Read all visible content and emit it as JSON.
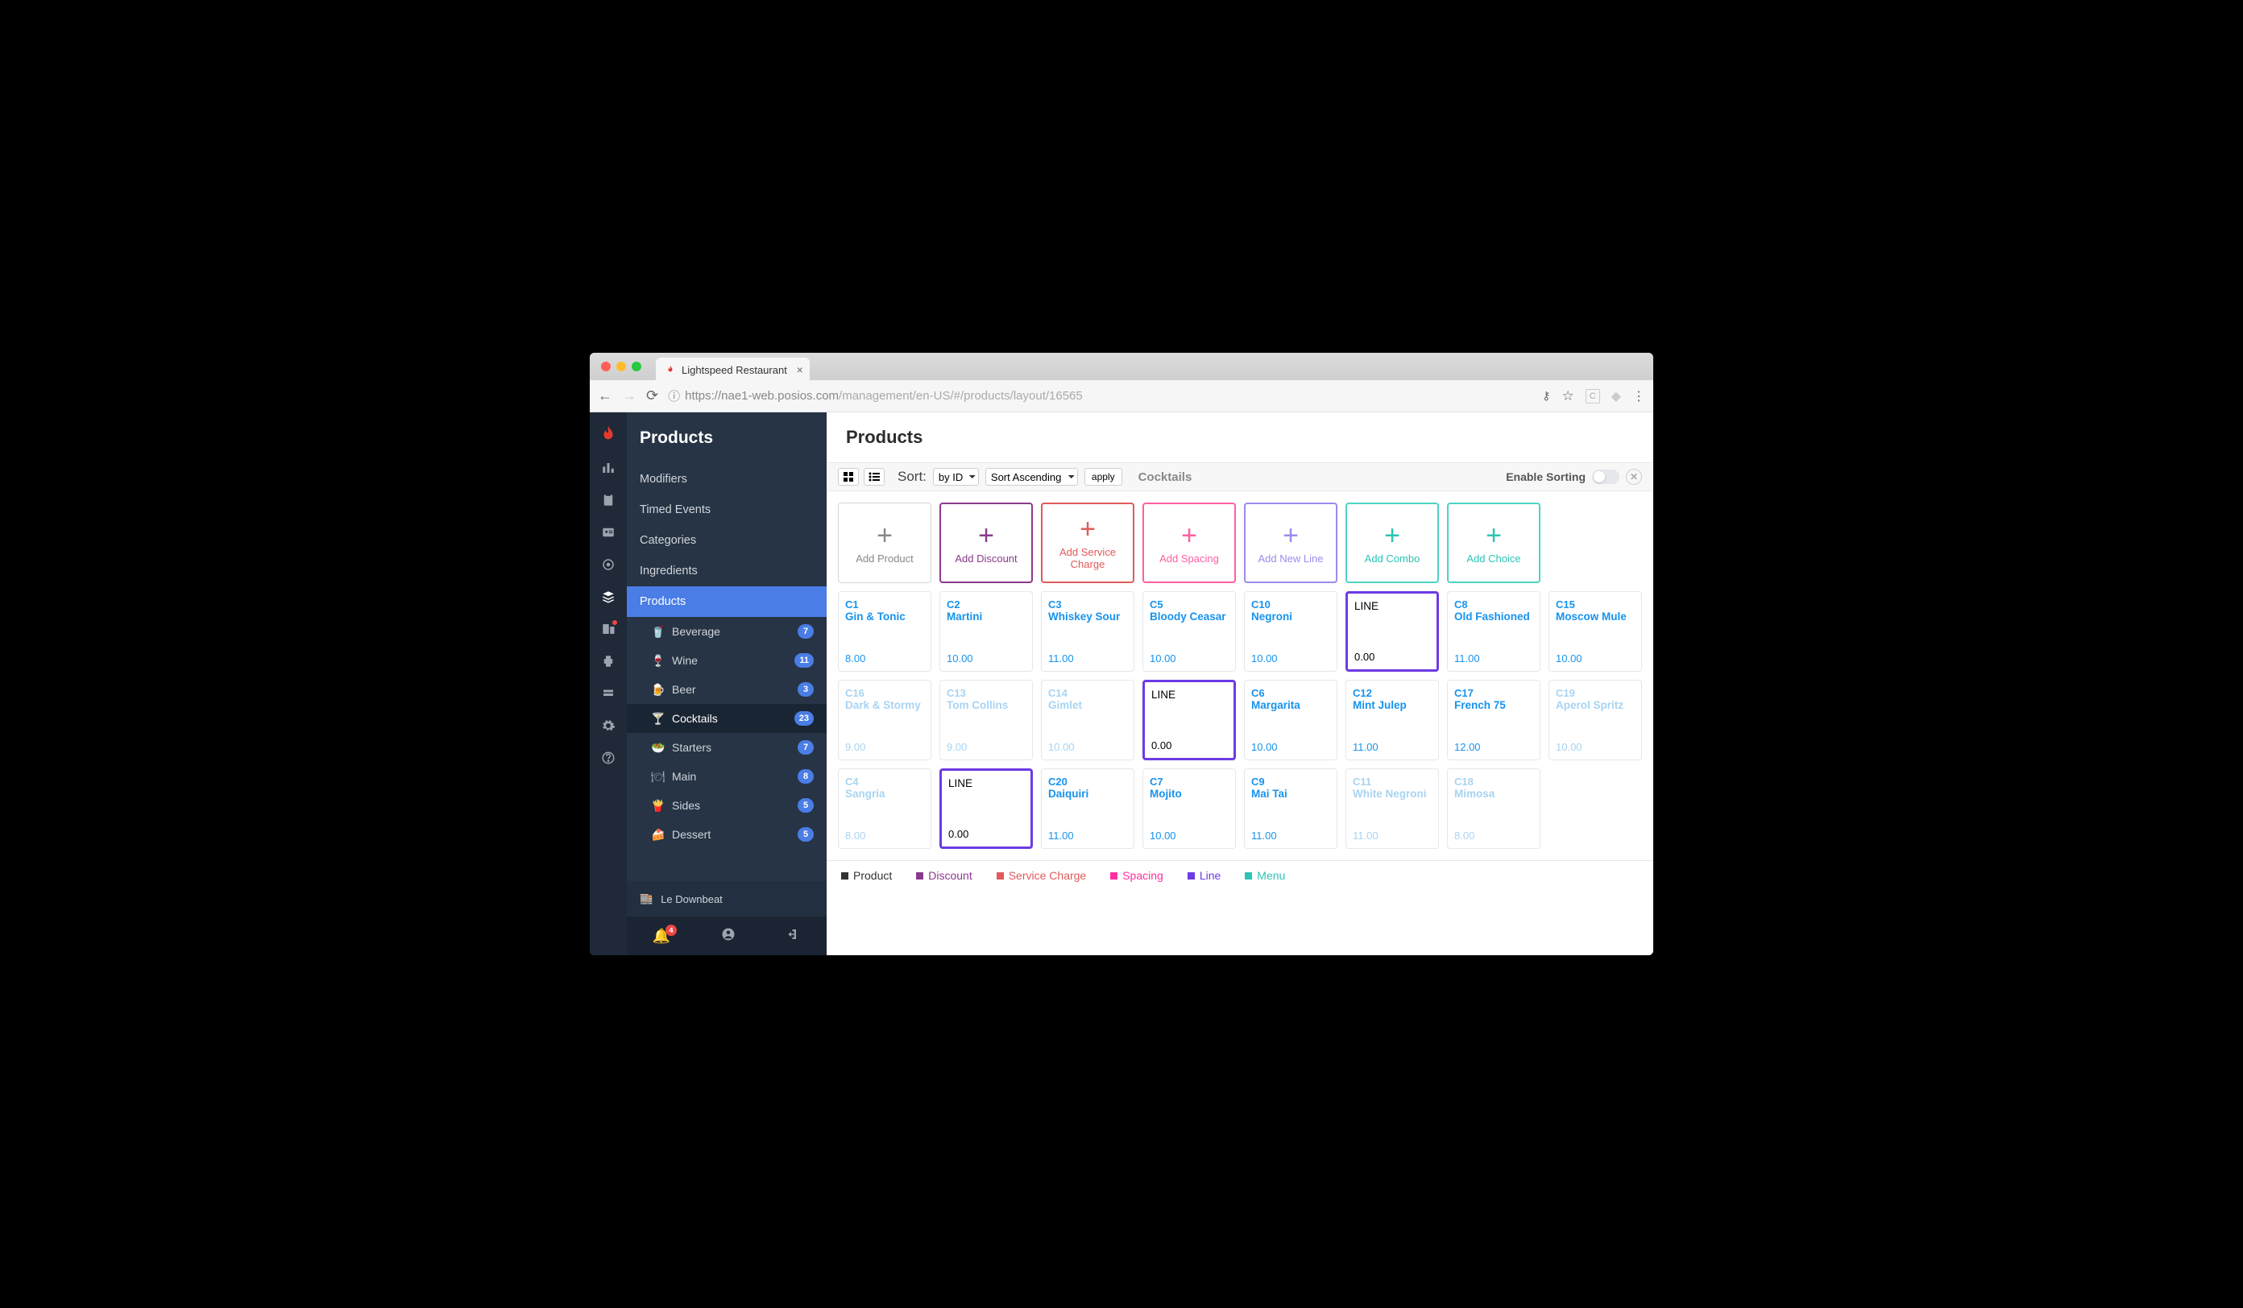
{
  "tab_title": "Lightspeed Restaurant",
  "url_host": "https://nae1-web.posios.com",
  "url_path": "/management/en-US/#/products/layout/16565",
  "sidebar": {
    "title": "Products",
    "items": [
      "Modifiers",
      "Timed Events",
      "Categories",
      "Ingredients",
      "Products"
    ],
    "subitems": [
      {
        "label": "Beverage",
        "count": "7"
      },
      {
        "label": "Wine",
        "count": "11"
      },
      {
        "label": "Beer",
        "count": "3"
      },
      {
        "label": "Cocktails",
        "count": "23"
      },
      {
        "label": "Starters",
        "count": "7"
      },
      {
        "label": "Main",
        "count": "8"
      },
      {
        "label": "Sides",
        "count": "5"
      },
      {
        "label": "Dessert",
        "count": "5"
      }
    ],
    "store": "Le Downbeat",
    "bell_count": "4"
  },
  "page_title": "Products",
  "toolbar": {
    "sort_label": "Sort:",
    "sort_field": "by ID",
    "sort_dir": "Sort Ascending",
    "apply": "apply",
    "crumb": "Cocktails",
    "enable_sorting": "Enable Sorting"
  },
  "add_cards": [
    {
      "cls": "add-product",
      "label": "Add Product"
    },
    {
      "cls": "add-discount",
      "label": "Add Discount"
    },
    {
      "cls": "add-service",
      "label": "Add Service Charge"
    },
    {
      "cls": "add-spacing",
      "label": "Add Spacing"
    },
    {
      "cls": "add-newline",
      "label": "Add New Line"
    },
    {
      "cls": "add-combo",
      "label": "Add Combo"
    },
    {
      "cls": "add-choice",
      "label": "Add Choice"
    }
  ],
  "cards": [
    {
      "type": "p",
      "code": "C1",
      "name": "Gin & Tonic",
      "price": "8.00"
    },
    {
      "type": "p",
      "code": "C2",
      "name": "Martini",
      "price": "10.00"
    },
    {
      "type": "p",
      "code": "C3",
      "name": "Whiskey Sour",
      "price": "11.00"
    },
    {
      "type": "p",
      "code": "C5",
      "name": "Bloody Ceasar",
      "price": "10.00"
    },
    {
      "type": "p",
      "code": "C10",
      "name": "Negroni",
      "price": "10.00"
    },
    {
      "type": "line",
      "title": "LINE",
      "price": "0.00"
    },
    {
      "type": "p",
      "code": "C8",
      "name": "Old Fashioned",
      "price": "11.00"
    },
    {
      "type": "p",
      "code": "C15",
      "name": "Moscow Mule",
      "price": "10.00"
    },
    {
      "type": "p",
      "faded": true,
      "code": "C16",
      "name": "Dark & Stormy",
      "price": "9.00"
    },
    {
      "type": "p",
      "faded": true,
      "code": "C13",
      "name": "Tom Collins",
      "price": "9.00"
    },
    {
      "type": "p",
      "faded": true,
      "code": "C14",
      "name": "Gimlet",
      "price": "10.00"
    },
    {
      "type": "line",
      "title": "LINE",
      "price": "0.00"
    },
    {
      "type": "p",
      "code": "C6",
      "name": "Margarita",
      "price": "10.00"
    },
    {
      "type": "p",
      "code": "C12",
      "name": "Mint Julep",
      "price": "11.00"
    },
    {
      "type": "p",
      "code": "C17",
      "name": "French 75",
      "price": "12.00"
    },
    {
      "type": "p",
      "faded": true,
      "code": "C19",
      "name": "Aperol Spritz",
      "price": "10.00"
    },
    {
      "type": "p",
      "faded": true,
      "code": "C4",
      "name": "Sangria",
      "price": "8.00"
    },
    {
      "type": "line",
      "title": "LINE",
      "price": "0.00"
    },
    {
      "type": "p",
      "code": "C20",
      "name": "Daiquiri",
      "price": "11.00"
    },
    {
      "type": "p",
      "code": "C7",
      "name": "Mojito",
      "price": "10.00"
    },
    {
      "type": "p",
      "code": "C9",
      "name": "Mai Tai",
      "price": "11.00"
    },
    {
      "type": "p",
      "faded": true,
      "code": "C11",
      "name": "White Negroni",
      "price": "11.00"
    },
    {
      "type": "p",
      "faded": true,
      "code": "C18",
      "name": "Mimosa",
      "price": "8.00"
    }
  ],
  "legend": [
    {
      "color": "#333",
      "label": "Product"
    },
    {
      "color": "#8b3a8b",
      "label": "Discount"
    },
    {
      "color": "#e05a5a",
      "label": "Service Charge"
    },
    {
      "color": "#ff2fa0",
      "label": "Spacing"
    },
    {
      "color": "#6d3be4",
      "label": "Line"
    },
    {
      "color": "#2dc4b4",
      "label": "Menu"
    }
  ]
}
